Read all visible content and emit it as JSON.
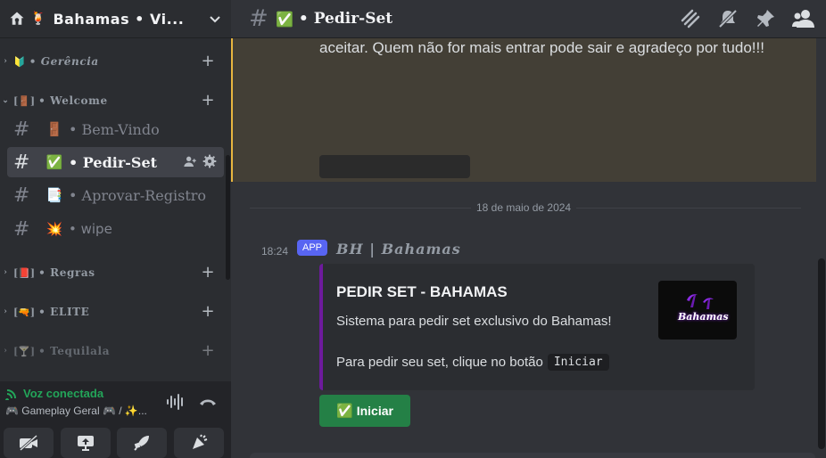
{
  "server": {
    "name": "Bahamas • Vi...",
    "icon": "house-icon",
    "badge_emoji": "🍹"
  },
  "categories": [
    {
      "emoji": "🔰",
      "label": "• Gerência"
    },
    {
      "emoji": "[🚪]",
      "label": "• Welcome"
    },
    {
      "emoji": "[📕]",
      "label": "• Regras"
    },
    {
      "emoji": "[🔫]",
      "label": "• ELITE"
    },
    {
      "emoji": "[🍸]",
      "label": "• Tequilala"
    }
  ],
  "channels": [
    {
      "emoji": "🚪",
      "name": "• Bem-Vindo"
    },
    {
      "emoji": "✅",
      "name": "• Pedir-Set"
    },
    {
      "emoji": "📑",
      "name": "• Aprovar-Registro"
    },
    {
      "emoji": "💥",
      "name": "• wipe"
    }
  ],
  "voice": {
    "status": "Voz conectada",
    "channel": "🎮 Gameplay Geral 🎮  /  ✨..."
  },
  "topbar": {
    "emoji": "✅",
    "title": "• Pedir-Set"
  },
  "pinned": {
    "text": "aceitar. Quem não for mais entrar pode sair e agradeço por tudo!!!"
  },
  "date_divider": "18 de maio de 2024",
  "message": {
    "time": "18:24",
    "badge": "APP",
    "author": "BH | Bahamas",
    "embed": {
      "title": "PEDIR SET - BAHAMAS",
      "description": "Sistema para pedir set exclusivo do Bahamas!",
      "instruction": "Para pedir seu set, clique no botão",
      "code": "Iniciar",
      "thumb_text": "Bahamas",
      "accent": "#6d1a9c"
    },
    "button": {
      "emoji": "✅",
      "label": "Iniciar",
      "color": "#248046"
    }
  }
}
